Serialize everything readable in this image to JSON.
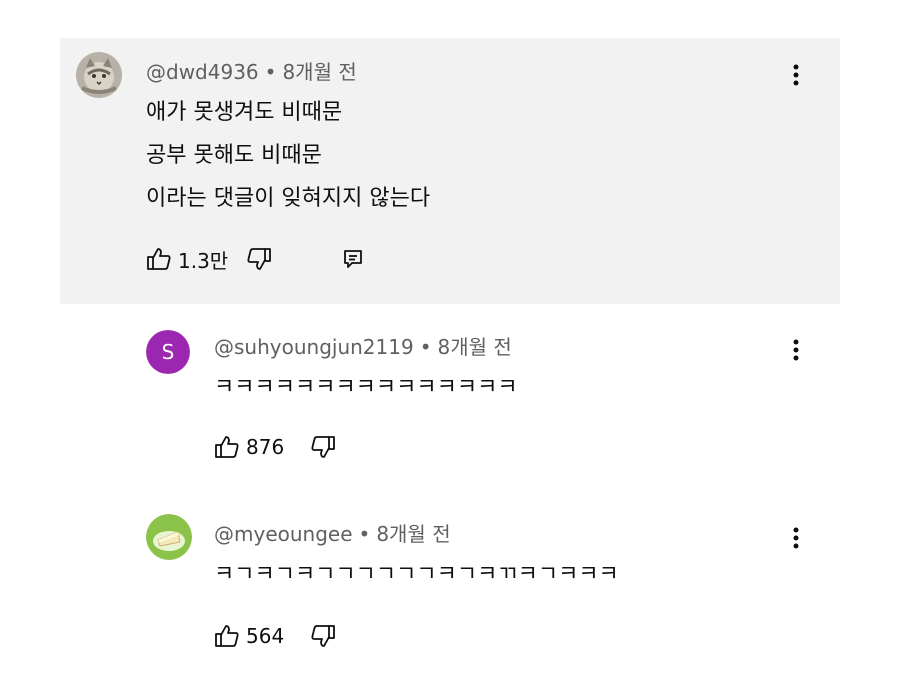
{
  "comments": [
    {
      "handle": "@dwd4936",
      "time": "8개월 전",
      "lines": [
        "애가 못생겨도 비때문",
        "공부 못해도 비때문",
        "이라는 댓글이 잊혀지지 않는다"
      ],
      "likes": "1.3만",
      "avatar_icon": "cat-photo-avatar"
    },
    {
      "handle": "@suhyoungjun2119",
      "time": "8개월 전",
      "lines": [
        "ㅋㅋㅋㅋㅋㅋㅋㅋㅋㅋㅋㅋㅋㅋㅋ"
      ],
      "likes": "876",
      "avatar_letter": "S",
      "avatar_color": "#9c27b0"
    },
    {
      "handle": "@myeoungee",
      "time": "8개월 전",
      "lines": [
        "ㅋㄱㅋㄱㅋㄱㄱㄱㄱㄱㄱㅋㄱㅋㄲㅋㄱㅋㅋㅋ"
      ],
      "likes": "564",
      "avatar_icon": "cake-avatar"
    }
  ],
  "colors": {
    "highlight_bg": "#f2f2f2",
    "meta_text": "#606060",
    "body_text": "#0f0f0f"
  }
}
